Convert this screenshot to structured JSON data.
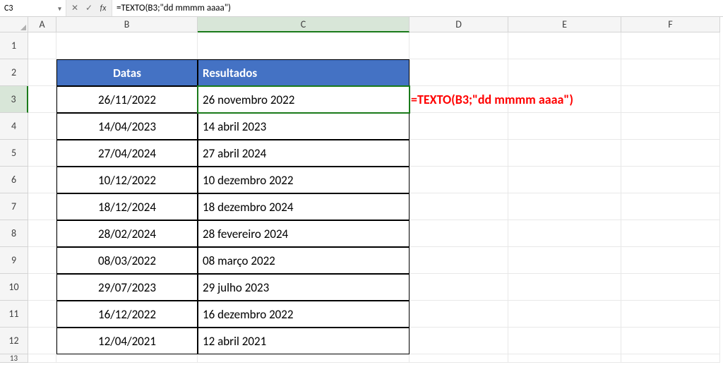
{
  "formula_bar": {
    "name_box": "C3",
    "cancel": "✕",
    "confirm": "✓",
    "fx": "fx",
    "formula": "=TEXTO(B3;\"dd mmmm aaaa\")"
  },
  "columns": [
    "A",
    "B",
    "C",
    "D",
    "E",
    "F"
  ],
  "row_numbers": [
    "1",
    "2",
    "3",
    "4",
    "5",
    "6",
    "7",
    "8",
    "9",
    "10",
    "11",
    "12",
    "13"
  ],
  "table": {
    "header_b": "Datas",
    "header_c": "Resultados",
    "rows": [
      {
        "b": "26/11/2022",
        "c": "26 novembro 2022"
      },
      {
        "b": "14/04/2023",
        "c": "14 abril 2023"
      },
      {
        "b": "27/04/2024",
        "c": "27 abril 2024"
      },
      {
        "b": "10/12/2022",
        "c": "10 dezembro 2022"
      },
      {
        "b": "18/12/2024",
        "c": "18 dezembro 2024"
      },
      {
        "b": "28/02/2024",
        "c": "28 fevereiro 2024"
      },
      {
        "b": "08/03/2022",
        "c": "08 março 2022"
      },
      {
        "b": "29/07/2023",
        "c": "29 julho 2023"
      },
      {
        "b": "16/12/2022",
        "c": "16 dezembro 2022"
      },
      {
        "b": "12/04/2021",
        "c": "12 abril 2021"
      }
    ]
  },
  "overlay_formula_text": "=TEXTO(B3;\"dd mmmm aaaa\")"
}
